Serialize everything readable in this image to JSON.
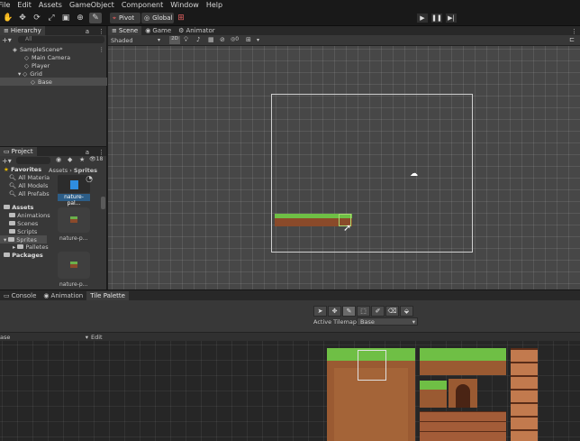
{
  "menu": [
    "File",
    "Edit",
    "Assets",
    "GameObject",
    "Component",
    "Window",
    "Help"
  ],
  "toolbar": {
    "pivot_label": "Pivot",
    "global_label": "Global"
  },
  "hierarchy": {
    "tab_label": "Hierarchy",
    "search_placeholder": "All",
    "items": [
      {
        "label": "SampleScene*",
        "indent": 0
      },
      {
        "label": "Main Camera",
        "indent": 1
      },
      {
        "label": "Player",
        "indent": 1
      },
      {
        "label": "Grid",
        "indent": 1
      },
      {
        "label": "Base",
        "indent": 2
      }
    ]
  },
  "project": {
    "tab_label": "Project",
    "count_badge": "18",
    "favorites_label": "Favorites",
    "favorites": [
      "All Materia",
      "All Models",
      "All Prefabs"
    ],
    "assets_label": "Assets",
    "folders": [
      "Animations",
      "Scenes",
      "Scripts",
      "Sprites",
      "Palletes"
    ],
    "packages_label": "Packages",
    "breadcrumb_root": "Assets",
    "breadcrumb_leaf": "Sprites",
    "thumbs": [
      "nature-pal...",
      "nature-p...",
      "nature-p..."
    ]
  },
  "scene": {
    "tabs": [
      "Scene",
      "Game",
      "Animator"
    ],
    "shading_mode": "Shaded",
    "dim_label": "2D"
  },
  "bottom": {
    "tabs": [
      "Console",
      "Animation",
      "Tile Palette"
    ],
    "active_tilemap_label": "Active Tilemap",
    "active_tilemap_value": "Base",
    "palette_value": "ase",
    "edit_label": "Edit"
  },
  "colors": {
    "selection": "#2c5d87",
    "accent": "#4a8ed6"
  }
}
